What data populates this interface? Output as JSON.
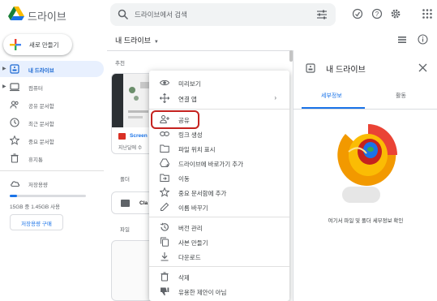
{
  "header": {
    "app_title": "드라이브",
    "search_placeholder": "드라이브에서 검색",
    "icons": [
      "drive-logo",
      "search-icon",
      "tune-icon",
      "offline-icon",
      "help-icon",
      "settings-icon",
      "apps-icon"
    ]
  },
  "sidebar": {
    "new_label": "새로 만들기",
    "items": [
      {
        "label": "내 드라이브",
        "icon": "my-drive-icon",
        "active": true,
        "expandable": true
      },
      {
        "label": "컴퓨터",
        "icon": "computer-icon",
        "active": false,
        "expandable": true
      },
      {
        "label": "공유 문서함",
        "icon": "shared-icon",
        "active": false,
        "expandable": false
      },
      {
        "label": "최근 문서함",
        "icon": "clock-icon",
        "active": false,
        "expandable": false
      },
      {
        "label": "중요 문서함",
        "icon": "star-icon",
        "active": false,
        "expandable": false
      },
      {
        "label": "휴지통",
        "icon": "trash-icon",
        "active": false,
        "expandable": false
      }
    ],
    "storage": {
      "label": "저장용량",
      "usage_text": "15GB 중 1.45GB 사용",
      "used_fraction": 0.097,
      "buy_label": "저장용량 구매"
    }
  },
  "main": {
    "title": "내 드라이브",
    "section_recommended": "추천",
    "recent_card": {
      "name": "Screen",
      "subtitle": "지난달에 수"
    },
    "section_folders": "폴더",
    "folder": {
      "name": "Cla"
    },
    "section_files": "파일"
  },
  "context_menu": {
    "items": [
      {
        "label": "미리보기",
        "icon": "eye-icon",
        "has_submenu": false
      },
      {
        "label": "연결 앱",
        "icon": "move-icon",
        "has_submenu": true
      },
      {
        "label": "공유",
        "icon": "person-add-icon",
        "has_submenu": false,
        "highlighted": true
      },
      {
        "label": "링크 생성",
        "icon": "link-icon",
        "has_submenu": false
      },
      {
        "label": "파일 위치 표시",
        "icon": "folder-icon",
        "has_submenu": false
      },
      {
        "label": "드라이브에 바로가기 추가",
        "icon": "shortcut-icon",
        "has_submenu": false
      },
      {
        "label": "이동",
        "icon": "folder-move-icon",
        "has_submenu": false
      },
      {
        "label": "중요 문서함에 추가",
        "icon": "star-icon",
        "has_submenu": false
      },
      {
        "label": "이름 바꾸기",
        "icon": "pencil-icon",
        "has_submenu": false
      },
      {
        "label": "버전 관리",
        "icon": "history-icon",
        "has_submenu": false
      },
      {
        "label": "사본 만들기",
        "icon": "copy-icon",
        "has_submenu": false
      },
      {
        "label": "다운로드",
        "icon": "download-icon",
        "has_submenu": false
      },
      {
        "label": "삭제",
        "icon": "trash-icon",
        "has_submenu": false
      },
      {
        "label": "유용한 제안이 아님",
        "icon": "thumb-down-icon",
        "has_submenu": false
      }
    ]
  },
  "details_panel": {
    "title": "내 드라이브",
    "tabs": [
      {
        "label": "세부정보",
        "active": true
      },
      {
        "label": "활동",
        "active": false
      }
    ],
    "empty_text": "여기서 파일 및 폴더 세부정보 확인"
  },
  "colors": {
    "accent": "#1a73e8",
    "active_bg": "#e8f0fe",
    "highlight_red": "#c5221f"
  }
}
